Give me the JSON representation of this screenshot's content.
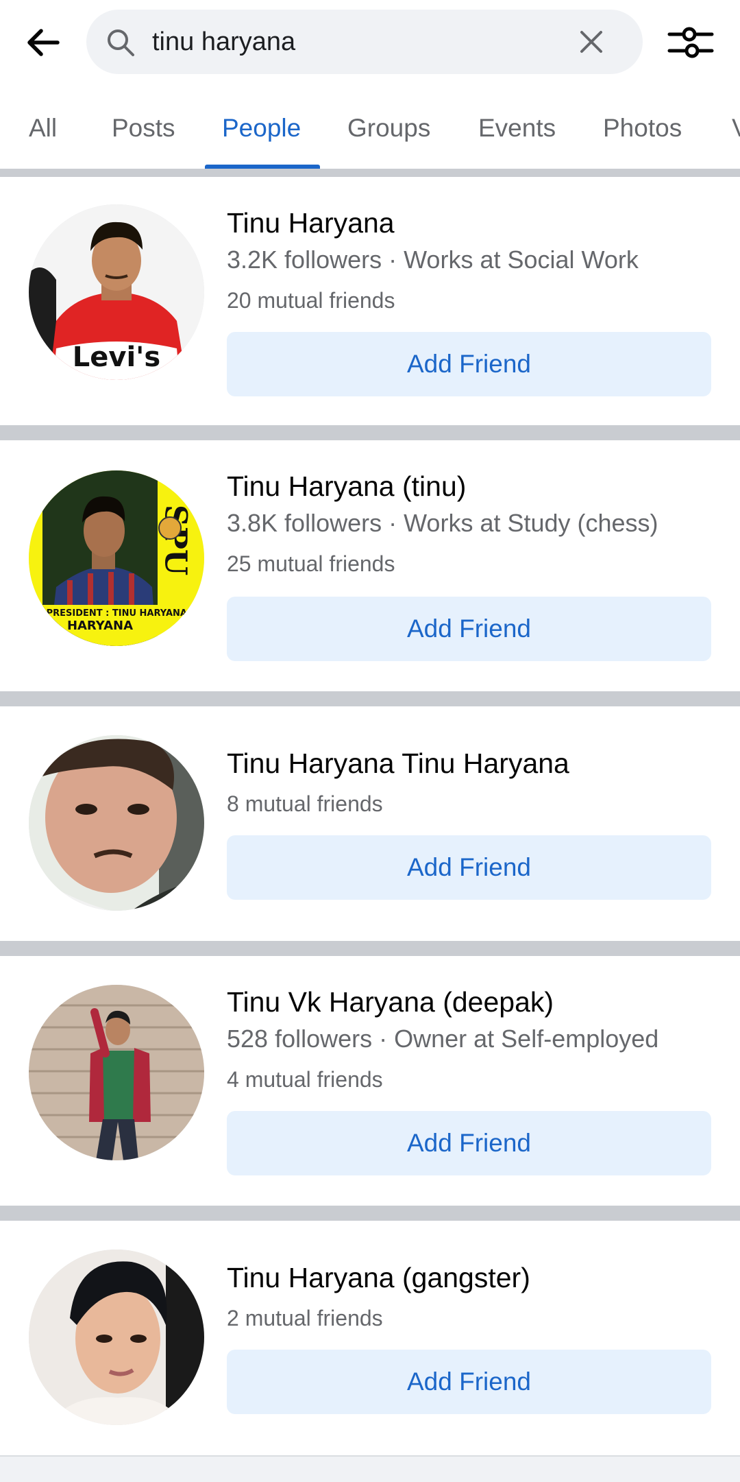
{
  "header": {
    "back_icon": "arrow-left-icon",
    "search_icon": "search-icon",
    "search_value": "tinu haryana",
    "clear_icon": "close-icon",
    "filter_icon": "sliders-icon"
  },
  "tabs": [
    {
      "label": "All",
      "active": false
    },
    {
      "label": "Posts",
      "active": false
    },
    {
      "label": "People",
      "active": true
    },
    {
      "label": "Groups",
      "active": false
    },
    {
      "label": "Events",
      "active": false
    },
    {
      "label": "Photos",
      "active": false
    },
    {
      "label": "V",
      "active": false
    }
  ],
  "results": [
    {
      "name": "Tinu Haryana",
      "meta": "3.2K followers · Works at Social Work",
      "mutual": "20 mutual friends",
      "button": "Add Friend",
      "avatar_shirt_text": "Levi's"
    },
    {
      "name": "Tinu Haryana (tinu)",
      "meta": "3.8K followers · Works at Study (chess)",
      "mutual": "25 mutual friends",
      "button": "Add Friend",
      "avatar_poster_line1": "STATE PRESIDENT : TINU HARYANA",
      "avatar_poster_line2": "HARYANA",
      "avatar_poster_letters": "SPU"
    },
    {
      "name": "Tinu Haryana Tinu Haryana",
      "meta": "",
      "mutual": "8 mutual friends",
      "button": "Add Friend"
    },
    {
      "name": "Tinu Vk Haryana (deepak)",
      "meta": "528 followers · Owner at Self-employed",
      "mutual": "4 mutual friends",
      "button": "Add Friend"
    },
    {
      "name": "Tinu Haryana (gangster)",
      "meta": "",
      "mutual": "2 mutual friends",
      "button": "Add Friend"
    }
  ],
  "colors": {
    "accent": "#1b66c9",
    "button_bg": "#e6f1fd",
    "separator": "#c9ccd1",
    "secondary_text": "#65676b"
  }
}
